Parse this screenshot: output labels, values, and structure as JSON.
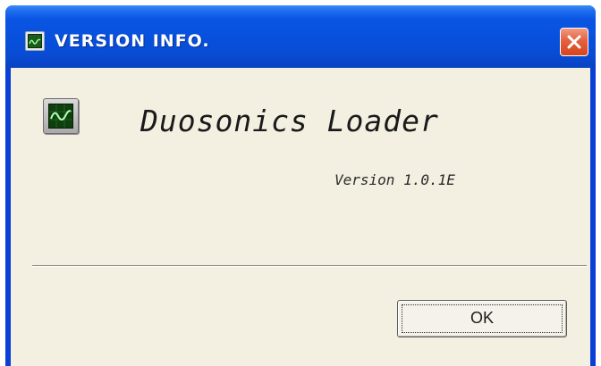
{
  "window": {
    "title": "VERSION INFO.",
    "title_icon": "waveform-monitor-icon",
    "close_icon": "close-icon",
    "colors": {
      "titlebar": "#0650dc",
      "close_button": "#e5613e",
      "client_background": "#f3efe1"
    }
  },
  "content": {
    "app_icon": "waveform-monitor-icon",
    "app_name": "Duosonics Loader",
    "version": "Version 1.0.1E"
  },
  "buttons": {
    "ok_label": "OK"
  }
}
